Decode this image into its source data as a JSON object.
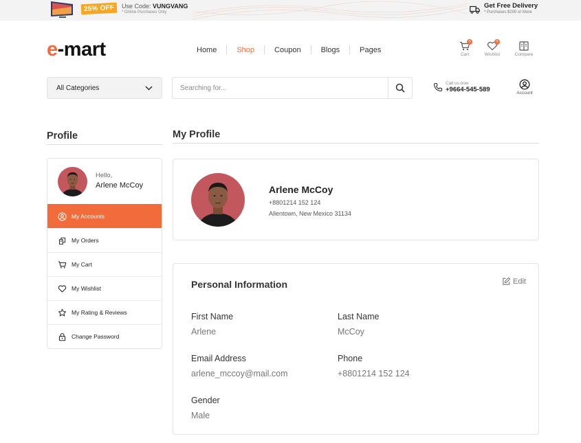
{
  "promo": {
    "discount": "25% OFF",
    "code_prefix": "Use Code:",
    "code": "VUNGVANG",
    "code_sub": "* Online Purchases Only",
    "delivery_title": "Get Free Delivery",
    "delivery_sub": "* Purchases $200 or More"
  },
  "header": {
    "logo_accent": "e",
    "logo_rest": "-mart",
    "nav": [
      "Home",
      "Shop",
      "Coupon",
      "Blogs",
      "Pages"
    ],
    "active_nav": "Shop",
    "cart_label": "Cart",
    "cart_count": "0",
    "wishlist_label": "Wishlist",
    "wishlist_count": "0",
    "compare_label": "Compare"
  },
  "search": {
    "category": "All Categories",
    "placeholder": "Searching for...",
    "call_label": "Call us now",
    "call_number": "+9664-545-589",
    "account_label": "Account"
  },
  "sidebar": {
    "title": "Profile",
    "greeting": "Hello,",
    "user_name": "Arlene McCoy",
    "items": [
      {
        "label": "My Accounts",
        "icon": "user-circle-icon",
        "active": true
      },
      {
        "label": "My Orders",
        "icon": "orders-icon",
        "active": false
      },
      {
        "label": "My Cart",
        "icon": "cart-icon",
        "active": false
      },
      {
        "label": "My Wishlist",
        "icon": "heart-icon",
        "active": false
      },
      {
        "label": "My Rating & Reviews",
        "icon": "star-icon",
        "active": false
      },
      {
        "label": "Change Password",
        "icon": "lock-icon",
        "active": false
      }
    ]
  },
  "profile": {
    "title": "My Profile",
    "name": "Arlene McCoy",
    "phone": "+8801214 152 124",
    "address": "Allentown, New Mexico 31134"
  },
  "personal_info": {
    "title": "Personal Information",
    "edit_label": "Edit",
    "first_name_label": "First Name",
    "first_name": "Arlene",
    "last_name_label": "Last Name",
    "last_name": "McCoy",
    "email_label": "Email Address",
    "email": "arlene_mccoy@mail.com",
    "phone_label": "Phone",
    "phone": "+8801214 152 124",
    "gender_label": "Gender",
    "gender": "Male"
  },
  "colors": {
    "accent": "#f26b3a",
    "badge": "#f5a623"
  }
}
